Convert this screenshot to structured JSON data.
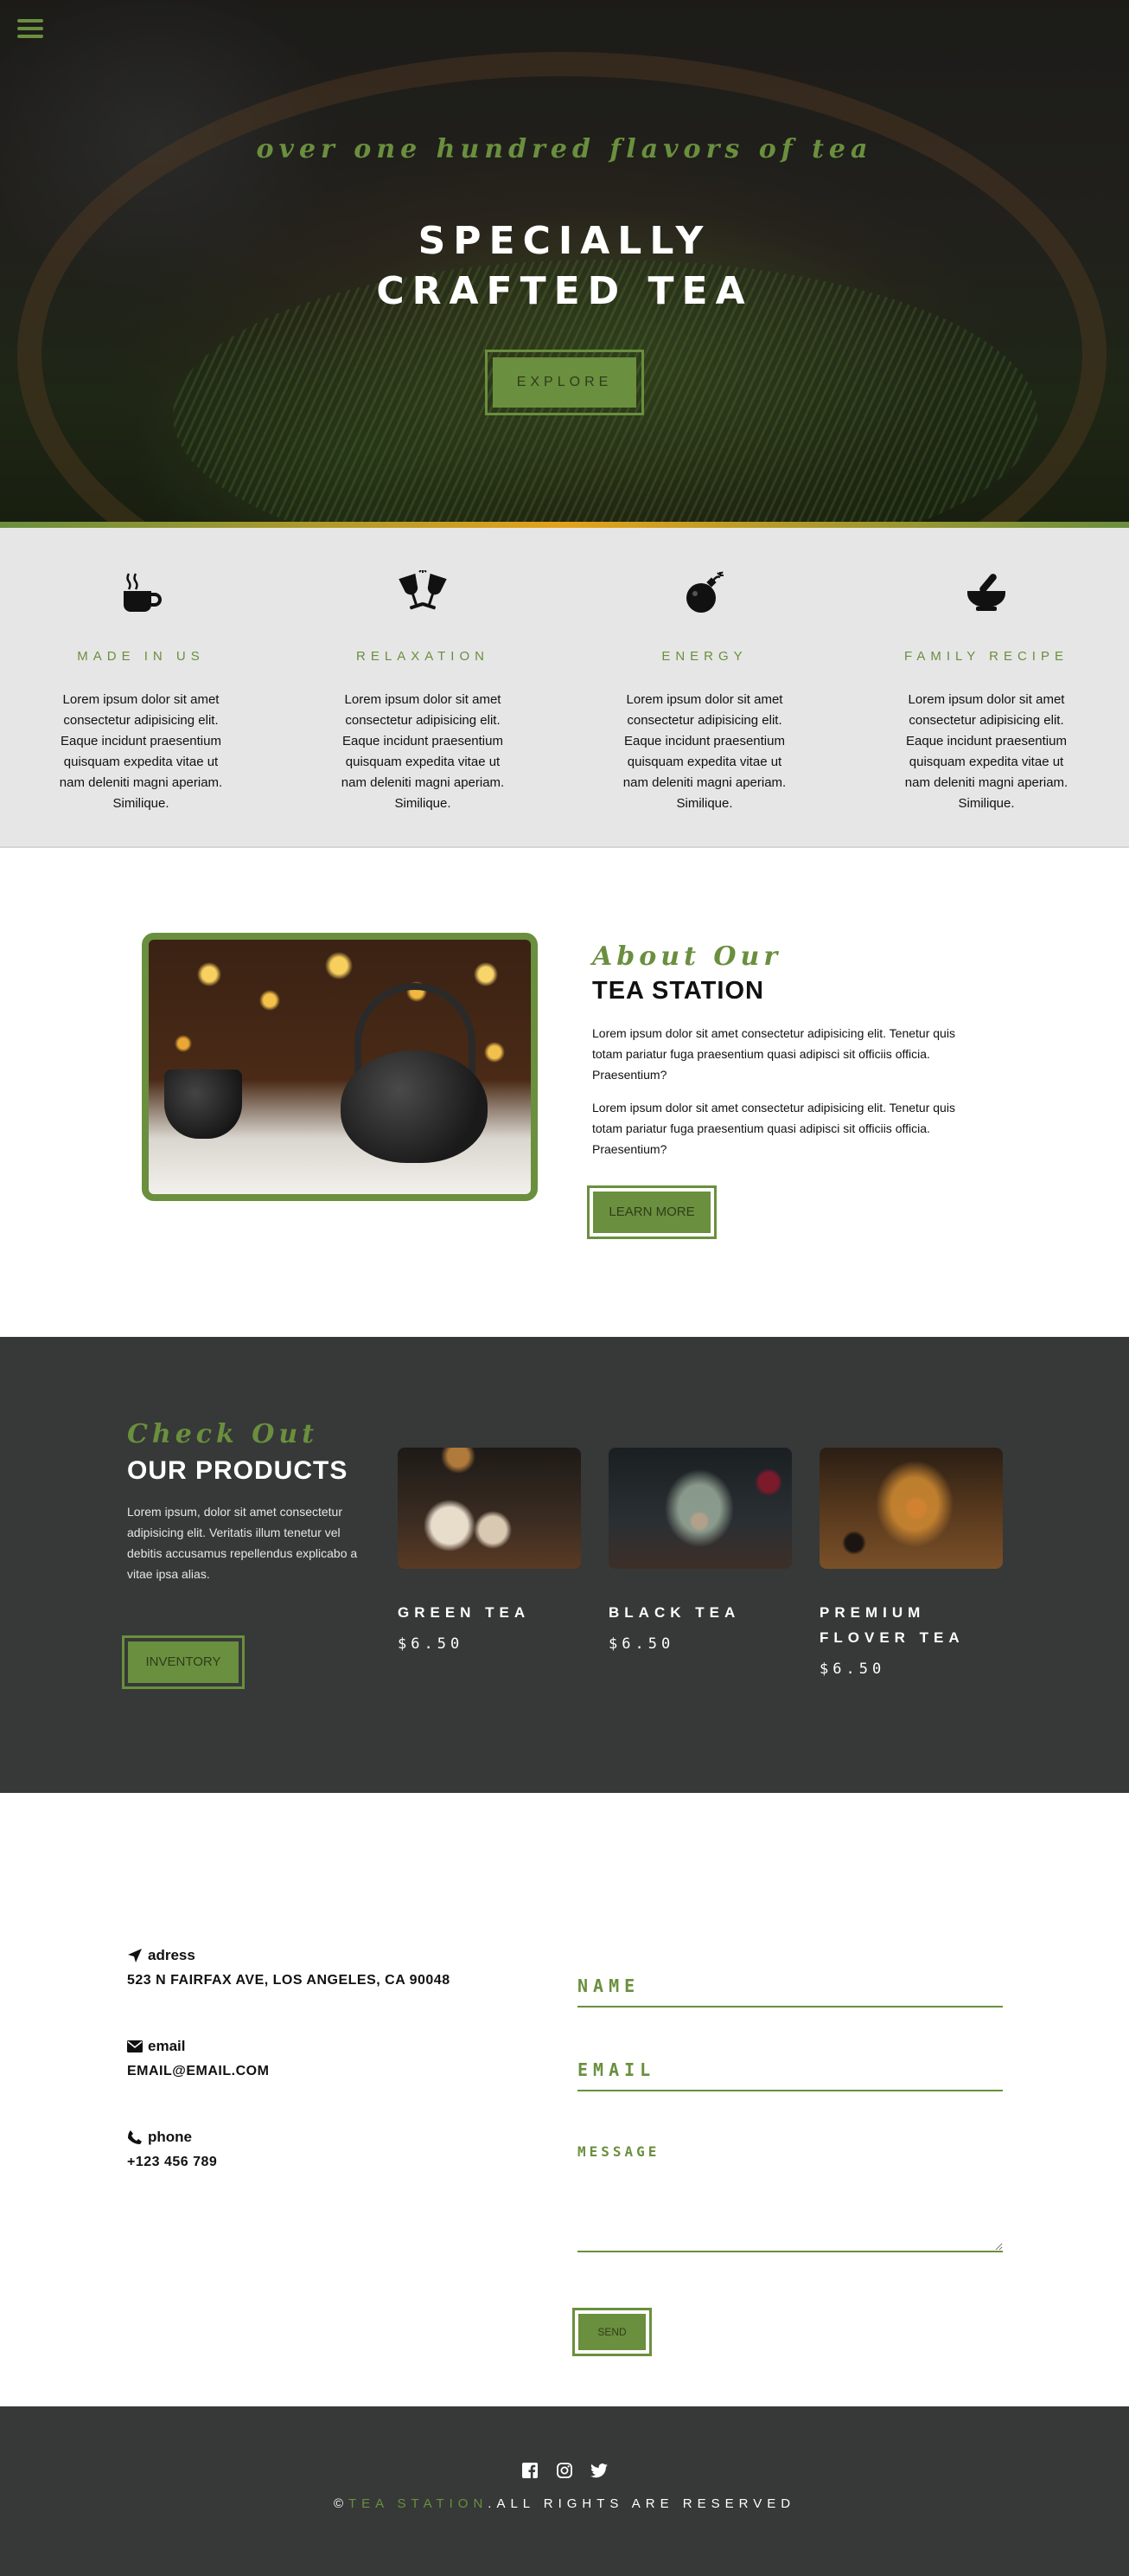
{
  "hero": {
    "tagline": "over one hundred flavors of tea",
    "title": "SPECIALLY CRAFTED TEA",
    "button": "EXPLORE"
  },
  "features": [
    {
      "icon": "coffee-cup-icon",
      "title": "MADE IN US",
      "text": "Lorem ipsum dolor sit amet consectetur adipisicing elit. Eaque incidunt praesentium quisquam expedita vitae ut nam deleniti magni aperiam. Similique."
    },
    {
      "icon": "wine-glasses-icon",
      "title": "RELAXATION",
      "text": "Lorem ipsum dolor sit amet consectetur adipisicing elit. Eaque incidunt praesentium quisquam expedita vitae ut nam deleniti magni aperiam. Similique."
    },
    {
      "icon": "bomb-icon",
      "title": "ENERGY",
      "text": "Lorem ipsum dolor sit amet consectetur adipisicing elit. Eaque incidunt praesentium quisquam expedita vitae ut nam deleniti magni aperiam. Similique."
    },
    {
      "icon": "mortar-pestle-icon",
      "title": "FAMILY RECIPE",
      "text": "Lorem ipsum dolor sit amet consectetur adipisicing elit. Eaque incidunt praesentium quisquam expedita vitae ut nam deleniti magni aperiam. Similique."
    }
  ],
  "about": {
    "script": "About Our",
    "heading": "TEA STATION",
    "para1": "Lorem ipsum dolor sit amet consectetur adipisicing elit. Tenetur quis totam pariatur fuga praesentium quasi adipisci sit officiis officia. Praesentium?",
    "para2": "Lorem ipsum dolor sit amet consectetur adipisicing elit. Tenetur quis totam pariatur fuga praesentium quasi adipisci sit officiis officia. Praesentium?",
    "button": "LEARN MORE"
  },
  "products": {
    "script": "Check Out",
    "heading": "OUR PRODUCTS",
    "para": "Lorem ipsum, dolor sit amet consectetur adipisicing elit. Veritatis illum tenetur vel debitis accusamus repellendus explicabo a vitae ipsa alias.",
    "button": "INVENTORY",
    "items": [
      {
        "name": "GREEN TEA",
        "price": "$6.50"
      },
      {
        "name": "BLACK TEA",
        "price": "$6.50"
      },
      {
        "name": "PREMIUM FLOVER TEA",
        "price": "$6.50"
      }
    ]
  },
  "contact": {
    "address_label": "adress",
    "address": "523 N FAIRFAX AVE, LOS ANGELES, CA 90048",
    "email_label": "email",
    "email": "EMAIL@EMAIL.COM",
    "phone_label": "phone",
    "phone": "+123 456 789",
    "form": {
      "name_placeholder": "NAME",
      "email_placeholder": "EMAIL",
      "message_placeholder": "MESSAGE",
      "send": "SEND"
    }
  },
  "footer": {
    "copyright_symbol": "©",
    "brand": "TEA STATION",
    "rights": ".ALL RIGHTS ARE RESERVED"
  },
  "colors": {
    "accent": "#6a8f3e",
    "dark": "#363937",
    "orange": "#e3a21b"
  }
}
